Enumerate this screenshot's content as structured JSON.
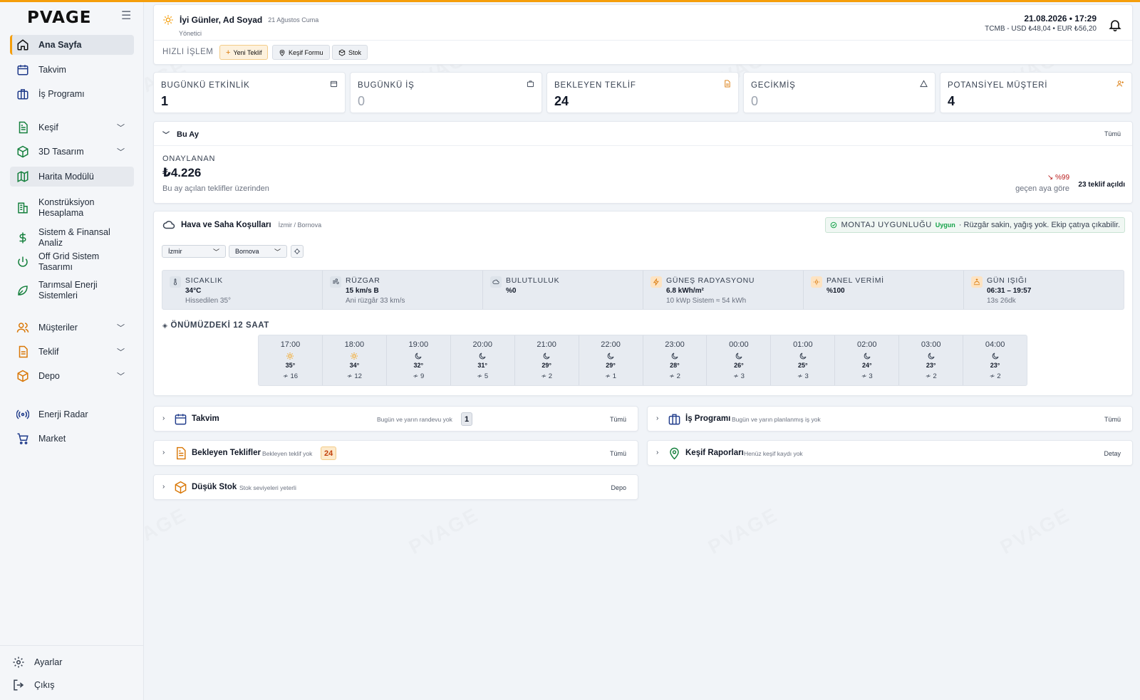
{
  "brand": {
    "logo": "PVAGE",
    "accent": "#f59e0b"
  },
  "sidebar": {
    "items": [
      {
        "label": "Ana Sayfa",
        "icon": "home-icon"
      },
      {
        "label": "Takvim",
        "icon": "calendar-icon"
      },
      {
        "label": "İş Programı",
        "icon": "briefcase-icon"
      },
      {
        "label": "Keşif",
        "icon": "document-icon"
      },
      {
        "label": "3D Tasarım",
        "icon": "cube-icon"
      },
      {
        "label": "Harita Modülü",
        "icon": "map-icon"
      },
      {
        "label": "Konstrüksiyon Hesaplama",
        "icon": "building-icon"
      },
      {
        "label": "Sistem & Finansal Analiz",
        "icon": "dollar-icon"
      },
      {
        "label": "Off Grid Sistem Tasarımı",
        "icon": "power-icon"
      },
      {
        "label": "Tarımsal Enerji Sistemleri",
        "icon": "leaf-icon"
      },
      {
        "label": "Müşteriler",
        "icon": "users-icon"
      },
      {
        "label": "Teklif",
        "icon": "file-icon"
      },
      {
        "label": "Depo",
        "icon": "package-icon"
      },
      {
        "label": "Enerji Radar",
        "icon": "radar-icon"
      },
      {
        "label": "Market",
        "icon": "cart-icon"
      }
    ],
    "bottom": [
      {
        "label": "Ayarlar",
        "icon": "gear-icon"
      },
      {
        "label": "Çıkış",
        "icon": "logout-icon"
      }
    ]
  },
  "header": {
    "greeting": "İyi Günler, Ad Soyad",
    "date_text": "21 Ağustos Cuma",
    "role": "Yönetici",
    "datetime": "21.08.2026 • 17:29",
    "rates": "TCMB -  USD ₺48,04 • EUR ₺56,20",
    "quick_label": "HIZLI İŞLEM",
    "quick_actions": [
      "Yeni Teklif",
      "Keşif Formu",
      "Stok"
    ]
  },
  "stats": [
    {
      "title": "BUGÜNKÜ ETKİNLİK",
      "value": "1"
    },
    {
      "title": "BUGÜNKÜ İŞ",
      "value": "0"
    },
    {
      "title": "BEKLEYEN TEKLİF",
      "value": "24"
    },
    {
      "title": "GECİKMİŞ",
      "value": "0"
    },
    {
      "title": "POTANSİYEL MÜŞTERİ",
      "value": "4"
    }
  ],
  "month": {
    "title": "Bu Ay",
    "all_label": "Tümü",
    "approved_title": "ONAYLANAN",
    "approved_value": "₺4.226",
    "approved_sub": "Bu ay açılan teklifler üzerinden",
    "trend": "↘ %99",
    "trend_sub": "geçen aya göre",
    "opened": "23 teklif açıldı"
  },
  "weather": {
    "title": "Hava ve Saha Koşulları",
    "location": "İzmir / Bornova",
    "montaj_title": "MONTAJ UYGUNLUĞU",
    "montaj_status": "Uygun",
    "montaj_text": "· Rüzgâr sakin, yağış yok. Ekip çatıya çıkabilir.",
    "city": "İzmir",
    "district": "Bornova",
    "metrics": [
      {
        "title": "SICAKLIK",
        "value": "34°C",
        "sub": "Hissedilen 35°"
      },
      {
        "title": "RÜZGAR",
        "value": "15 km/s B",
        "sub": "Ani rüzgâr 33 km/s"
      },
      {
        "title": "BULUTLULUK",
        "value": "%0",
        "sub": ""
      },
      {
        "title": "GÜNEŞ RADYASYONU",
        "value": "6.8 kWh/m²",
        "sub": "10 kWp Sistem ≈ 54 kWh"
      },
      {
        "title": "PANEL VERİMİ",
        "value": "%100",
        "sub": ""
      },
      {
        "title": "GÜN IŞIĞI",
        "value": "06:31 – 19:57",
        "sub": "13s 26dk"
      }
    ],
    "next_title": "ÖNÜMÜZDEKİ 12 SAAT",
    "hours": [
      {
        "time": "17:00",
        "icon": "sun",
        "temp": "35°",
        "wind": "16"
      },
      {
        "time": "18:00",
        "icon": "sun",
        "temp": "34°",
        "wind": "12"
      },
      {
        "time": "19:00",
        "icon": "moon",
        "temp": "32°",
        "wind": "9"
      },
      {
        "time": "20:00",
        "icon": "moon",
        "temp": "31°",
        "wind": "5"
      },
      {
        "time": "21:00",
        "icon": "moon",
        "temp": "29°",
        "wind": "2"
      },
      {
        "time": "22:00",
        "icon": "moon",
        "temp": "29°",
        "wind": "1"
      },
      {
        "time": "23:00",
        "icon": "moon",
        "temp": "28°",
        "wind": "2"
      },
      {
        "time": "00:00",
        "icon": "moon",
        "temp": "26°",
        "wind": "3"
      },
      {
        "time": "01:00",
        "icon": "moon",
        "temp": "25°",
        "wind": "3"
      },
      {
        "time": "02:00",
        "icon": "moon",
        "temp": "24°",
        "wind": "3"
      },
      {
        "time": "03:00",
        "icon": "moon",
        "temp": "23°",
        "wind": "2"
      },
      {
        "time": "04:00",
        "icon": "moon",
        "temp": "23°",
        "wind": "2"
      }
    ]
  },
  "panels": {
    "takvim": {
      "title": "Takvim",
      "sub": "Bugün ve yarın randevu yok",
      "badge": "1",
      "link": "Tümü"
    },
    "is_programi": {
      "title": "İş Programı",
      "sub": "Bugün ve yarın planlanmış iş yok",
      "link": "Tümü"
    },
    "teklifler": {
      "title": "Bekleyen Teklifler",
      "sub": "Bekleyen teklif yok",
      "badge": "24",
      "link": "Tümü"
    },
    "kesif": {
      "title": "Keşif Raporları",
      "sub": "Henüz keşif kaydı yok",
      "link": "Detay"
    },
    "stok": {
      "title": "Düşük Stok",
      "sub": "Stok seviyeleri yeterli",
      "link": "Depo"
    }
  }
}
